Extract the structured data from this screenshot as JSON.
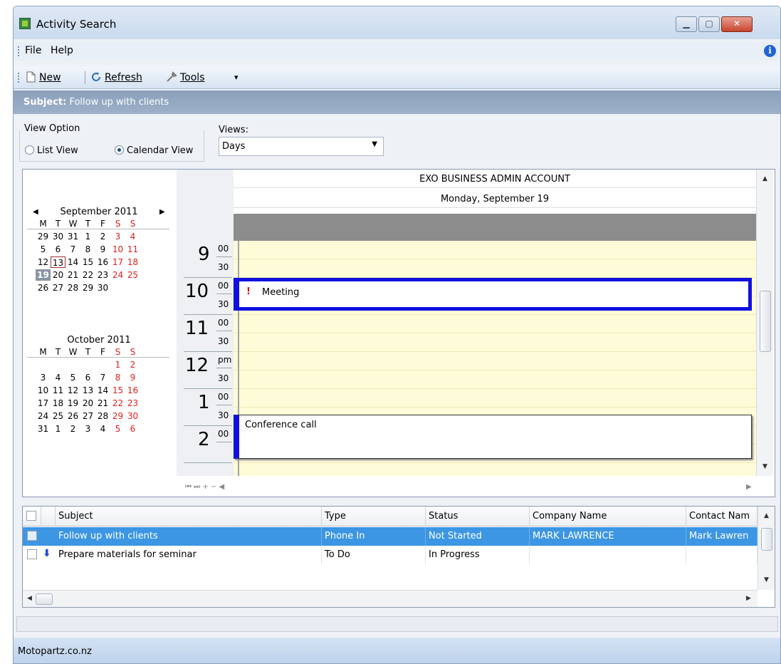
{
  "window": {
    "title": "Activity Search",
    "min": "▁",
    "max": "▢",
    "close": "✕"
  },
  "menu": {
    "file": "File",
    "help": "Help",
    "info": "i"
  },
  "toolbar": {
    "new_label": "New",
    "refresh_label": "Refresh",
    "tools_label": "Tools",
    "dropdown": "▾"
  },
  "subject_bar": {
    "prefix": "Subject:",
    "value": "Follow up with clients"
  },
  "view_option": {
    "legend": "View Option",
    "list_view": "List View",
    "calendar_view": "Calendar View",
    "selected": "Calendar View"
  },
  "views": {
    "label": "Views:",
    "value": "Days"
  },
  "mini_calendar": {
    "prev": "◀",
    "next": "▶",
    "weekday_headers": [
      "M",
      "T",
      "W",
      "T",
      "F",
      "S",
      "S"
    ],
    "months": [
      {
        "title": "September 2011",
        "weeks": [
          [
            "29",
            "30",
            "31",
            "1",
            "2",
            "3",
            "4"
          ],
          [
            "5",
            "6",
            "7",
            "8",
            "9",
            "10",
            "11"
          ],
          [
            "12",
            "13",
            "14",
            "15",
            "16",
            "17",
            "18"
          ],
          [
            "19",
            "20",
            "21",
            "22",
            "23",
            "24",
            "25"
          ],
          [
            "26",
            "27",
            "28",
            "29",
            "30",
            "",
            ""
          ]
        ],
        "today": "13",
        "selected": "19"
      },
      {
        "title": "October 2011",
        "weeks": [
          [
            "",
            "",
            "",
            "",
            "",
            "1",
            "2"
          ],
          [
            "3",
            "4",
            "5",
            "6",
            "7",
            "8",
            "9"
          ],
          [
            "10",
            "11",
            "12",
            "13",
            "14",
            "15",
            "16"
          ],
          [
            "17",
            "18",
            "19",
            "20",
            "21",
            "22",
            "23"
          ],
          [
            "24",
            "25",
            "26",
            "27",
            "28",
            "29",
            "30"
          ],
          [
            "31",
            "1",
            "2",
            "3",
            "4",
            "5",
            "6"
          ]
        ]
      }
    ]
  },
  "schedule": {
    "resource": "EXO BUSINESS ADMIN ACCOUNT",
    "date": "Monday, September 19",
    "times": [
      {
        "hour": "9",
        "top": "00",
        "bottom": "30"
      },
      {
        "hour": "10",
        "top": "00",
        "bottom": "30"
      },
      {
        "hour": "11",
        "top": "00",
        "bottom": "30"
      },
      {
        "hour": "12",
        "top": "pm",
        "bottom": "30"
      },
      {
        "hour": "1",
        "top": "00",
        "bottom": "30"
      },
      {
        "hour": "2",
        "top": "00",
        "bottom": ""
      }
    ],
    "appointments": [
      {
        "subject": "Meeting",
        "flag": "!"
      },
      {
        "subject": "Conference call"
      }
    ],
    "nav": "⏮ ⏭ + − ◀"
  },
  "grid": {
    "columns": [
      "Subject",
      "Type",
      "Status",
      "Company Name",
      "Contact Nam"
    ],
    "rows": [
      {
        "subject": "Follow up with clients",
        "type": "Phone In",
        "status": "Not Started",
        "company": "MARK LAWRENCE",
        "contact": "Mark Lawren",
        "selected": true
      },
      {
        "subject": "Prepare materials for seminar",
        "type": "To Do",
        "status": "In Progress",
        "company": "",
        "contact": "",
        "priority_icon": "down-arrow"
      }
    ]
  },
  "status": {
    "text": "Motopartz.co.nz"
  }
}
